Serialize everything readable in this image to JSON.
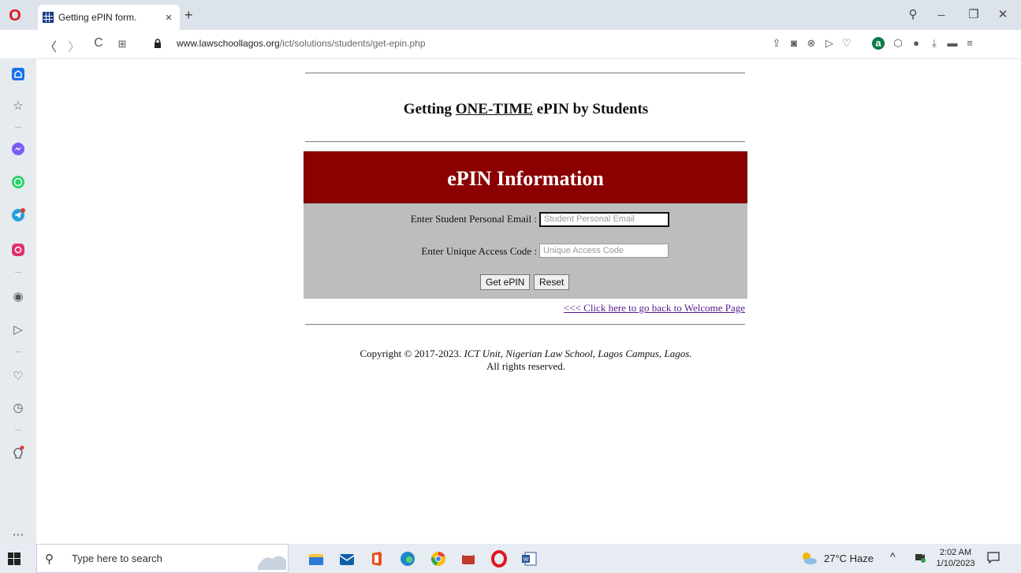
{
  "browser": {
    "tab_title": "Getting ePIN form.",
    "tab_close": "×",
    "new_tab": "+",
    "url_host": "www.lawschoollagos.org",
    "url_path": "/ict/solutions/students/get-epin.php",
    "window_controls": {
      "search": "⚲",
      "minimize": "_",
      "restore": "❐",
      "close": "✕"
    },
    "nav": {
      "back": "〈",
      "forward": "〉",
      "reload": "C",
      "speed_dial": "⊞"
    }
  },
  "page": {
    "title_prefix": "Getting ",
    "title_emphasis": "ONE-TIME",
    "title_suffix": " ePIN by Students",
    "form_heading": "ePIN Information",
    "email_label": "Enter Student Personal Email :",
    "email_placeholder": "Student Personal Email",
    "access_label": "Enter Unique Access Code :",
    "access_placeholder": "Unique Access Code",
    "submit_label": "Get ePIN",
    "reset_label": "Reset",
    "back_link": "<<< Click here to go back to Welcome Page",
    "copyright_prefix": "Copyright © 2017-2023. ",
    "copyright_org": "ICT Unit, Nigerian Law School, Lagos Campus, Lagos.",
    "copyright_line2": "All rights reserved."
  },
  "taskbar": {
    "search_placeholder": "Type here to search",
    "weather": "27°C  Haze",
    "tray_chevron": "^",
    "time": "2:02 AM",
    "date": "1/10/2023"
  },
  "colors": {
    "form_header": "#8b0000",
    "form_body": "#bdbdbd",
    "visited_link": "#551a8b",
    "opera_red": "#e0161e"
  }
}
